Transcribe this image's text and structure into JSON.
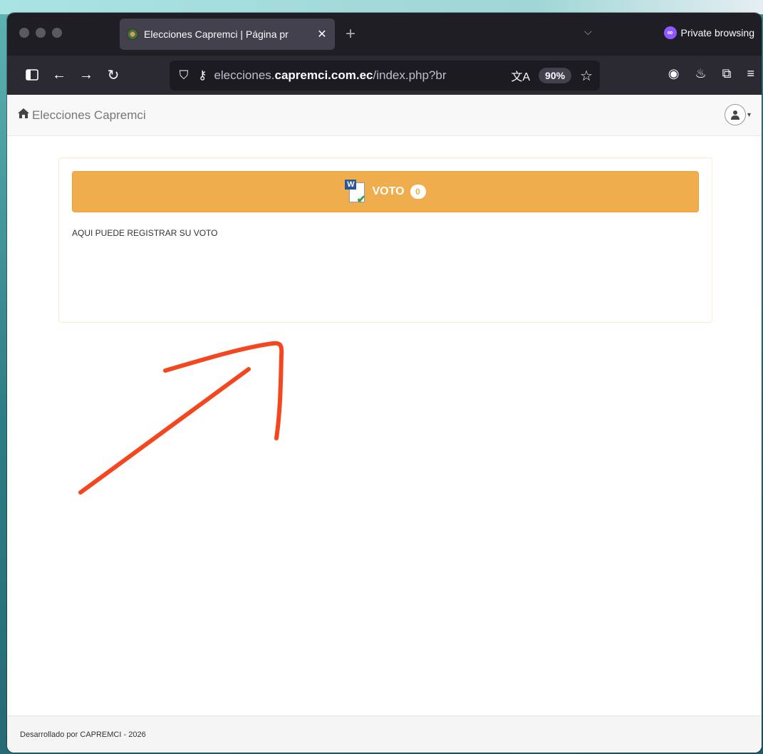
{
  "browser": {
    "tab_title": "Elecciones Capremci | Página pr",
    "tab_close": "✕",
    "new_tab": "+",
    "tab_list": "⌵",
    "private_label": "Private browsing",
    "url_prefix": "elecciones.",
    "url_domain": "capremci.com.ec",
    "url_rest": "/index.php?br",
    "zoom": "90%",
    "translate_icon": "文A"
  },
  "navbar": {
    "brand": "Elecciones Capremci"
  },
  "panel": {
    "button_label": "VOTO",
    "badge_count": "0",
    "description": "AQUI PUEDE REGISTRAR SU VOTO"
  },
  "footer": {
    "text": "Desarrollado por CAPREMCI - 2026"
  },
  "colors": {
    "vote_button": "#f0ad4e",
    "annotation_arrow": "#f4461f"
  },
  "icons": [
    "home-icon",
    "user-icon",
    "document-check-icon",
    "shield-icon",
    "key-icon",
    "star-icon"
  ]
}
